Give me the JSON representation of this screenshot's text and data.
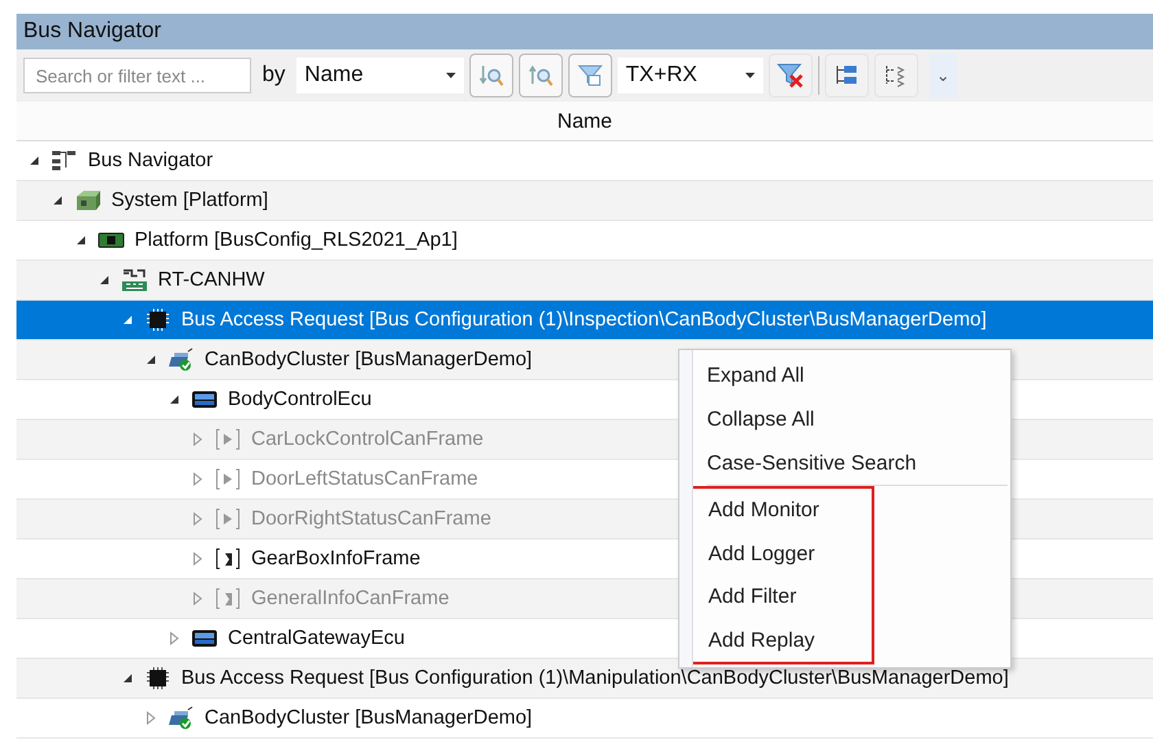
{
  "panel": {
    "title": "Bus Navigator"
  },
  "toolbar": {
    "search": {
      "placeholder": "Search or filter text ..."
    },
    "by_label": "by",
    "field_dropdown": {
      "value": "Name"
    },
    "direction_dropdown": {
      "value": "TX+RX"
    },
    "overflow": "⌄"
  },
  "column": {
    "heading": "Name"
  },
  "tree": [
    {
      "label": "Bus Navigator",
      "kind": "navigator",
      "expanded": true,
      "disabled": false,
      "selected": false,
      "children": [
        {
          "label": "System [Platform]",
          "kind": "system",
          "expanded": true,
          "disabled": false,
          "selected": false,
          "children": [
            {
              "label": "Platform [BusConfig_RLS2021_Ap1]",
              "kind": "platform",
              "expanded": true,
              "disabled": false,
              "selected": false,
              "children": [
                {
                  "label": "RT-CANHW",
                  "kind": "can",
                  "expanded": true,
                  "disabled": false,
                  "selected": false,
                  "children": [
                    {
                      "label": "Bus Access Request [Bus Configuration (1)\\Inspection\\CanBodyCluster\\BusManagerDemo]",
                      "kind": "chip",
                      "expanded": true,
                      "disabled": false,
                      "selected": true,
                      "children": [
                        {
                          "label": "CanBodyCluster [BusManagerDemo]",
                          "kind": "cluster",
                          "expanded": true,
                          "disabled": false,
                          "selected": false,
                          "children": [
                            {
                              "label": "BodyControlEcu",
                              "kind": "ecu",
                              "expanded": true,
                              "disabled": false,
                              "selected": false,
                              "children": [
                                {
                                  "label": "CarLockControlCanFrame",
                                  "kind": "frame_tx",
                                  "expanded": false,
                                  "disabled": true,
                                  "selected": false
                                },
                                {
                                  "label": "DoorLeftStatusCanFrame",
                                  "kind": "frame_tx",
                                  "expanded": false,
                                  "disabled": true,
                                  "selected": false
                                },
                                {
                                  "label": "DoorRightStatusCanFrame",
                                  "kind": "frame_tx",
                                  "expanded": false,
                                  "disabled": true,
                                  "selected": false
                                },
                                {
                                  "label": "GearBoxInfoFrame",
                                  "kind": "frame_rx",
                                  "expanded": false,
                                  "disabled": false,
                                  "selected": false
                                },
                                {
                                  "label": "GeneralInfoCanFrame",
                                  "kind": "frame_rx",
                                  "expanded": false,
                                  "disabled": true,
                                  "selected": false
                                }
                              ]
                            },
                            {
                              "label": "CentralGatewayEcu",
                              "kind": "ecu",
                              "expanded": false,
                              "disabled": false,
                              "selected": false
                            }
                          ]
                        }
                      ]
                    },
                    {
                      "label": "Bus Access Request [Bus Configuration (1)\\Manipulation\\CanBodyCluster\\BusManagerDemo]",
                      "kind": "chip",
                      "expanded": true,
                      "disabled": false,
                      "selected": false,
                      "children": [
                        {
                          "label": "CanBodyCluster [BusManagerDemo]",
                          "kind": "cluster",
                          "expanded": false,
                          "disabled": false,
                          "selected": false
                        }
                      ]
                    }
                  ]
                }
              ]
            }
          ]
        }
      ]
    }
  ],
  "context_menu": {
    "groups": [
      {
        "highlighted": false,
        "items": [
          "Expand All",
          "Collapse All",
          "Case-Sensitive Search"
        ]
      },
      {
        "highlighted": true,
        "items": [
          "Add Monitor",
          "Add Logger",
          "Add Filter",
          "Add Replay"
        ]
      }
    ]
  }
}
